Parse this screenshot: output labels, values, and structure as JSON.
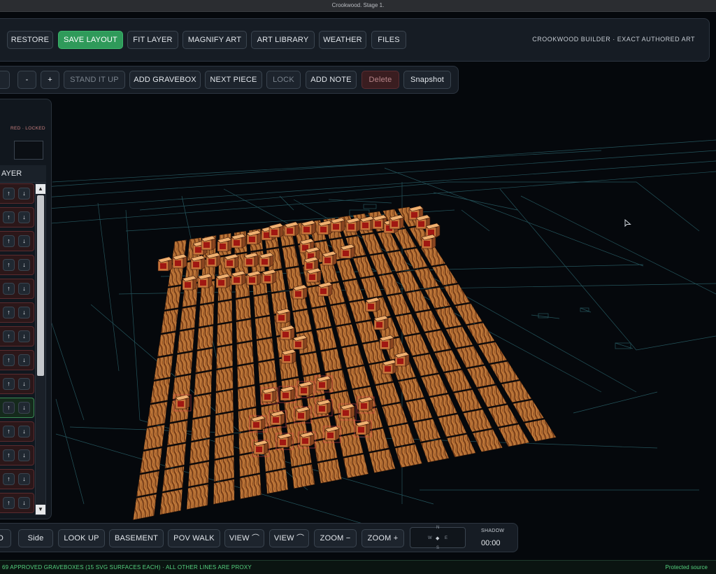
{
  "window": {
    "title": "Crookwood. Stage 1."
  },
  "toolbar": {
    "buttons": [
      "RESTORE",
      "SAVE LAYOUT",
      "FIT LAYER",
      "MAGNIFY ART",
      "ART LIBRARY",
      "WEATHER",
      "FILES"
    ],
    "brand": "CROOKWOOD BUILDER · EXACT AUTHORED ART"
  },
  "edit_toolbar": {
    "buttons": [
      "-",
      "+",
      "STAND IT UP",
      "ADD GRAVEBOX",
      "NEXT PIECE",
      "LOCK",
      "ADD NOTE",
      "Delete",
      "Snapshot"
    ]
  },
  "layer_panel": {
    "lock_legend": "RED · LOCKED",
    "header": "AYER",
    "up_arrow": "↑",
    "down_arrow": "↓",
    "scroll_up": "▲",
    "scroll_down": "▼",
    "row_states": [
      "locked",
      "locked",
      "locked",
      "locked",
      "locked",
      "locked",
      "locked",
      "locked",
      "locked",
      "active",
      "locked",
      "locked",
      "locked",
      "locked"
    ]
  },
  "view_toolbar": {
    "buttons": [
      "D",
      "Side",
      "LOOK UP",
      "BASEMENT",
      "POV WALK",
      "VIEW ⌒",
      "VIEW ⌒",
      "ZOOM −",
      "ZOOM +"
    ],
    "compass": {
      "n": "N",
      "s": "S",
      "w": "W",
      "e": "E",
      "center": "◆"
    },
    "shadow_label": "SHADOW",
    "shadow_time": "00:00"
  },
  "status": {
    "left": "69 APPROVED GRAVEBOXES (15 SVG SURFACES EACH) · ALL OTHER LINES ARE PROXY",
    "right": "Protected source"
  },
  "colors": {
    "accent_green": "#2f9a5a",
    "locked_red": "#5b2b2e",
    "status_green": "#55d27f",
    "wood": "#b8702e",
    "grid_line": "#2f6f78"
  }
}
